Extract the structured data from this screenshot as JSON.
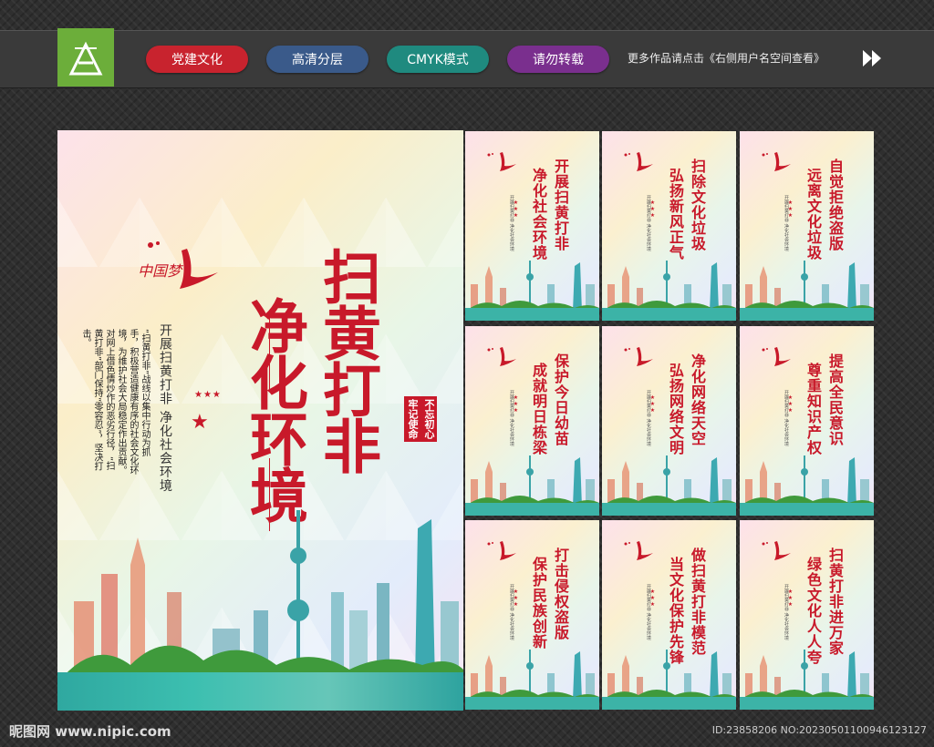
{
  "header": {
    "tags": [
      {
        "label": "党建文化",
        "color": "#c8232e"
      },
      {
        "label": "高清分层",
        "color": "#3a5a8a"
      },
      {
        "label": "CMYK模式",
        "color": "#1f8a7f"
      },
      {
        "label": "请勿转载",
        "color": "#7a2f8e"
      }
    ],
    "notice": "更多作品请点击《右侧用户名空间查看》"
  },
  "main_poster": {
    "title_line1": "扫黄打非",
    "title_line2": "净化环境",
    "subtitle": "开展扫黄打非 净化社会环境",
    "paragraph": "“扫黄打非”战线以集中行动为抓手，积极营造健康有序的社会文化环境，为维护社会大局稳定作出贡献。对网上借色情炒作的恶劣行径，“扫黄打非”部门保持“零容忍”，坚决打击。",
    "slogan1": "不忘初心",
    "slogan2": "牢记使命",
    "stars": "★★★",
    "logo_text": "中国梦"
  },
  "small_posters": [
    {
      "line1": "开展扫黄打非",
      "line2": "净化社会环境"
    },
    {
      "line1": "扫除文化垃圾",
      "line2": "弘扬新风正气"
    },
    {
      "line1": "自觉拒绝盗版",
      "line2": "远离文化垃圾"
    },
    {
      "line1": "保护今日幼苗",
      "line2": "成就明日栋梁"
    },
    {
      "line1": "净化网络天空",
      "line2": "弘扬网络文明"
    },
    {
      "line1": "提高全民意识",
      "line2": "尊重知识产权"
    },
    {
      "line1": "打击侵权盗版",
      "line2": "保护民族创新"
    },
    {
      "line1": "做扫黄打非模范",
      "line2": "当文化保护先锋"
    },
    {
      "line1": "扫黄打非进万家",
      "line2": "绿色文化人人夸"
    }
  ],
  "small_poster_tiny": "开展扫黄打非 净化社会环境",
  "footer": {
    "watermark": "昵图网 www.nipic.com",
    "image_id": "ID:23858206 NO:20230501100946123127"
  }
}
